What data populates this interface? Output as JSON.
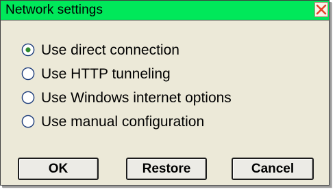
{
  "window": {
    "title": "Network settings",
    "titlebar_color": "#00e85a",
    "background_color": "#ece9d8",
    "close_icon": "close-x-icon",
    "close_icon_color": "#e8402a"
  },
  "connection_options": {
    "selected_index": 0,
    "items": [
      {
        "label": "Use direct connection",
        "selected": true
      },
      {
        "label": "Use HTTP tunneling",
        "selected": false
      },
      {
        "label": "Use Windows internet options",
        "selected": false
      },
      {
        "label": "Use manual configuration",
        "selected": false
      }
    ]
  },
  "buttons": {
    "ok_label": "OK",
    "restore_label": "Restore",
    "cancel_label": "Cancel"
  }
}
